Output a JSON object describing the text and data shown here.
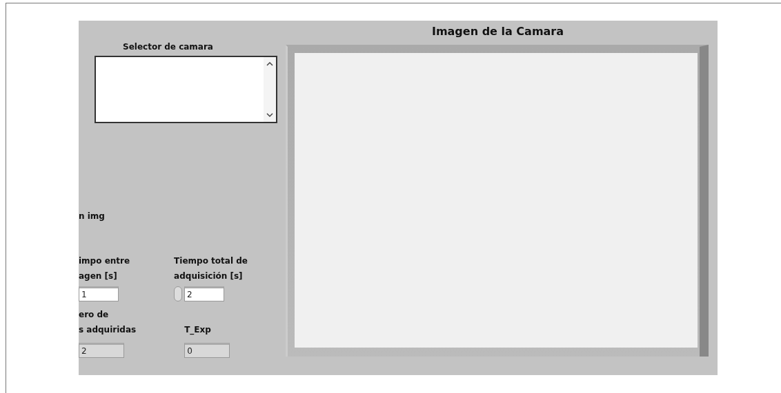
{
  "camera_selector": {
    "label": "Selector de camara"
  },
  "image_display": {
    "title": "Imagen de la Camara"
  },
  "img_label": "n img",
  "controls": [
    {
      "label_lines": [
        "impo entre",
        "agen [s]"
      ],
      "value": "1",
      "kind": "control"
    },
    {
      "label_lines": [
        "Tiempo total de",
        "adquisición  [s]"
      ],
      "value": "2",
      "kind": "spinner"
    }
  ],
  "indicators": [
    {
      "label_lines": [
        "ero de",
        "s adquiridas"
      ],
      "value": "2"
    },
    {
      "label_lines": [
        "T_Exp"
      ],
      "value": "0"
    }
  ]
}
